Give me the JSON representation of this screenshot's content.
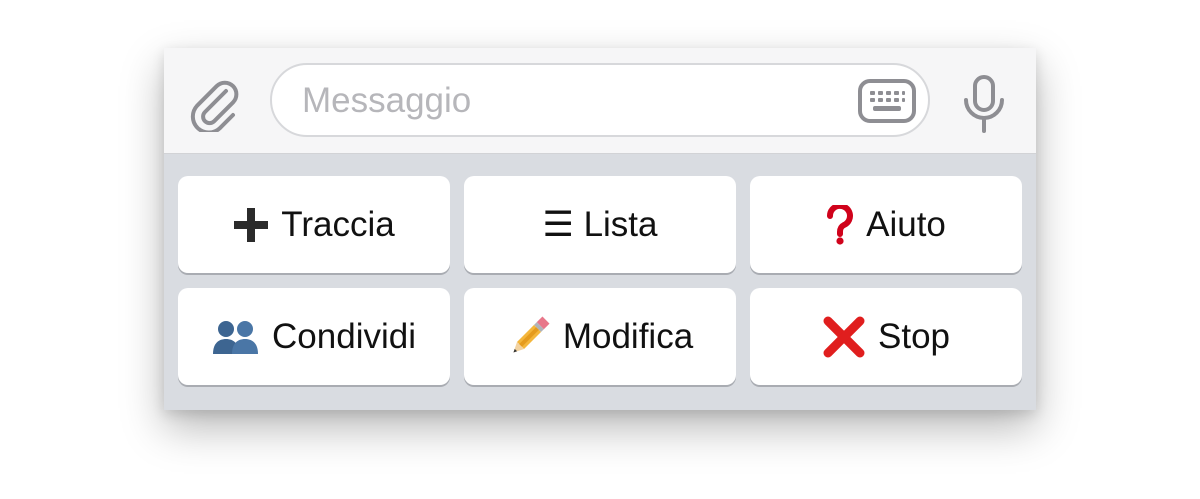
{
  "composer": {
    "placeholder": "Messaggio",
    "value": "",
    "attach_icon": "paperclip-icon",
    "keyboard_icon": "keyboard-icon",
    "mic_icon": "microphone-icon"
  },
  "keyboard": {
    "buttons": [
      {
        "label": "Traccia",
        "icon": "plus-icon"
      },
      {
        "label": "☰ Lista",
        "icon": ""
      },
      {
        "label": "Aiuto",
        "icon": "question-mark-icon"
      },
      {
        "label": "Condividi",
        "icon": "people-icon"
      },
      {
        "label": "Modifica",
        "icon": "pencil-icon"
      },
      {
        "label": "Stop",
        "icon": "cross-mark-icon"
      }
    ]
  },
  "colors": {
    "panel_bg": "#d9dce1",
    "input_bar_bg": "#f6f6f7",
    "icon_gray": "#8e8e93",
    "question_red": "#d0021b",
    "cross_red": "#e01e1e"
  }
}
